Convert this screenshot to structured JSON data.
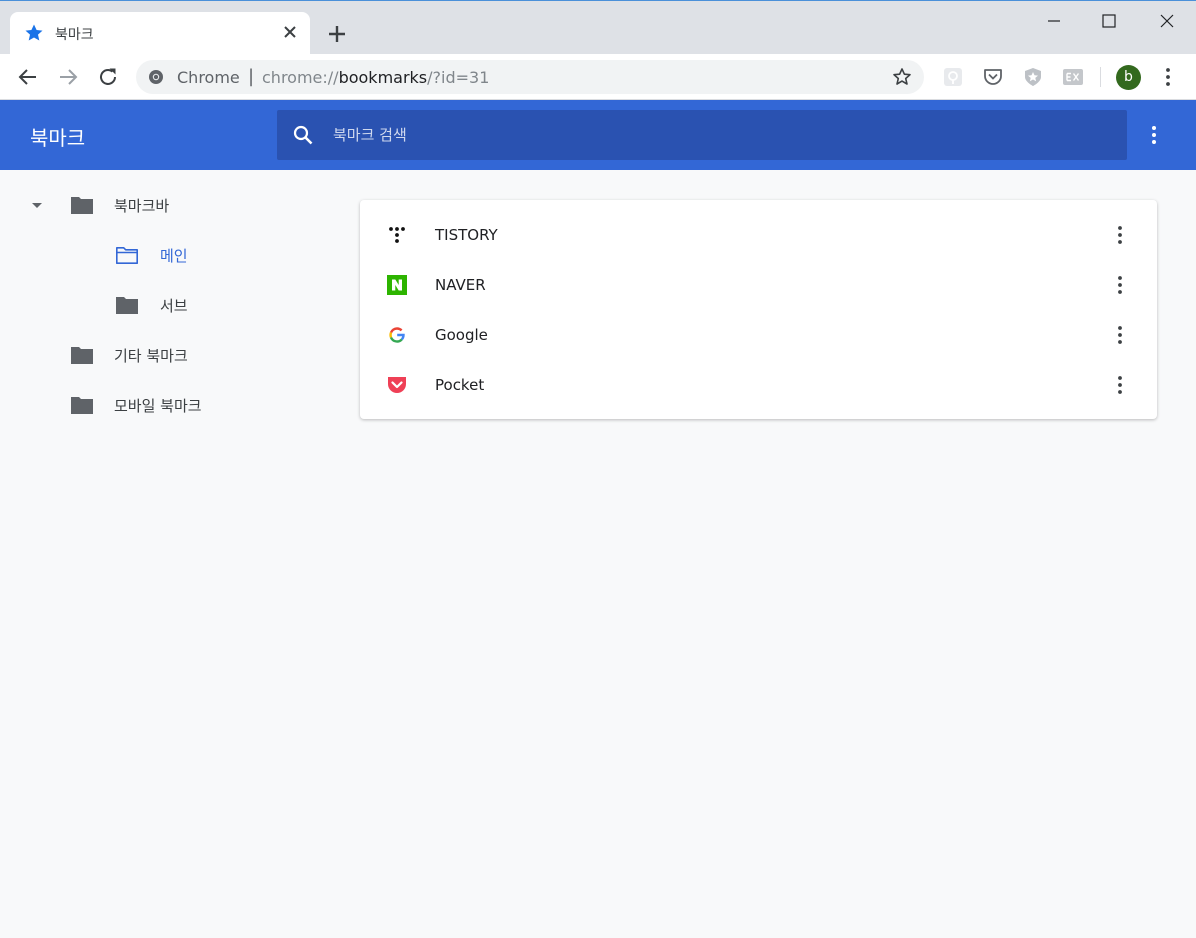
{
  "browser": {
    "tab": {
      "title": "북마크",
      "favicon": "star-icon",
      "favicon_color": "#1a73e8"
    },
    "address": {
      "site": "Chrome",
      "separator": "|",
      "url_prefix": "chrome://",
      "url_host": "bookmarks",
      "url_path": "/?id=31"
    },
    "profile_initial": "b",
    "profile_color": "#33691e"
  },
  "bookmarks": {
    "header_title": "북마크",
    "header_color": "#3367d6",
    "search_placeholder": "북마크 검색",
    "tree": [
      {
        "label": "북마크바",
        "expanded": true,
        "level": 0
      },
      {
        "label": "메인",
        "selected": true,
        "level": 1
      },
      {
        "label": "서브",
        "level": 1
      },
      {
        "label": "기타 북마크",
        "level": 0
      },
      {
        "label": "모바일 북마크",
        "level": 0
      }
    ],
    "items": [
      {
        "name": "TISTORY",
        "icon": "tistory-icon"
      },
      {
        "name": "NAVER",
        "icon": "naver-icon",
        "color": "#2db400"
      },
      {
        "name": "Google",
        "icon": "google-icon"
      },
      {
        "name": "Pocket",
        "icon": "pocket-icon",
        "color": "#ef4056"
      }
    ]
  }
}
